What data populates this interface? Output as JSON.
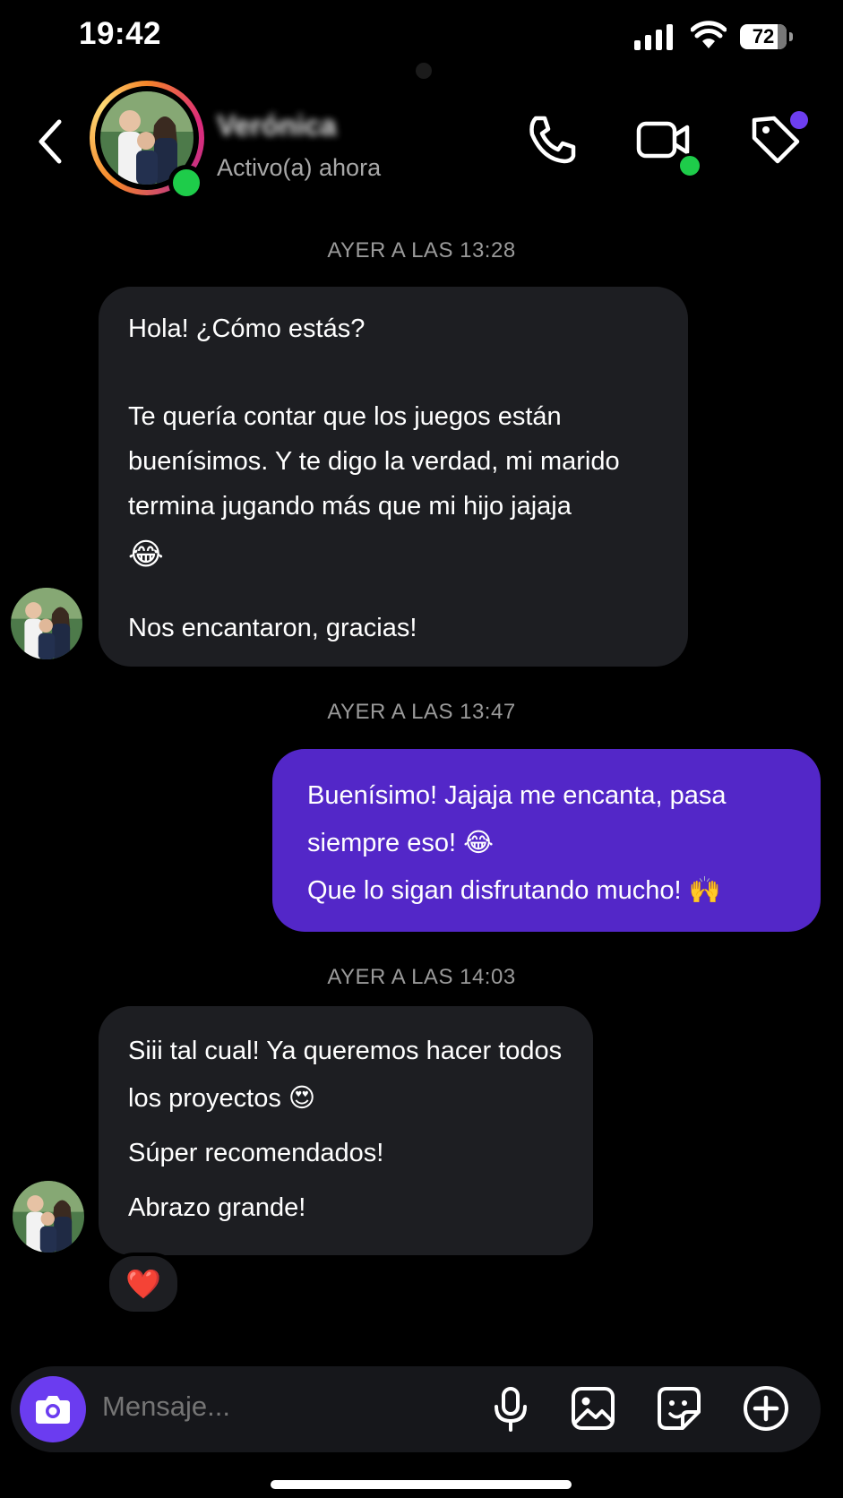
{
  "status_bar": {
    "time": "19:42",
    "battery": "72"
  },
  "header": {
    "contact_name": "Verónica",
    "status": "Activo(a) ahora",
    "icons": [
      "back-chevron-icon",
      "phone-icon",
      "video-call-icon",
      "tag-icon"
    ]
  },
  "conversation": [
    {
      "type": "timestamp",
      "text": "AYER A LAS 13:28"
    },
    {
      "type": "received",
      "paragraphs": [
        "Hola! ¿Cómo estás?",
        "Te quería contar que los juegos están buenísimos. Y te digo la verdad, mi marido termina jugando más que mi hijo jajaja",
        "😂",
        "Nos encantaron, gracias!"
      ]
    },
    {
      "type": "timestamp",
      "text": "AYER A LAS 13:47"
    },
    {
      "type": "sent",
      "paragraphs": [
        "Buenísimo! Jajaja me encanta, pasa siempre eso! 😂",
        "Que lo sigan disfrutando mucho! 🙌"
      ]
    },
    {
      "type": "timestamp",
      "text": "AYER A LAS 14:03"
    },
    {
      "type": "received",
      "paragraphs": [
        "Siii tal cual! Ya queremos hacer todos los proyectos 😍",
        "Súper recomendados!",
        "Abrazo grande!"
      ],
      "reaction": "❤️"
    }
  ],
  "composer": {
    "placeholder": "Mensaje...",
    "icons": [
      "camera-icon",
      "microphone-icon",
      "gallery-icon",
      "sticker-icon",
      "add-icon"
    ]
  },
  "colors": {
    "sent_bubble": "#5327c8",
    "received_bubble": "#1d1e22",
    "online": "#1ecc4a",
    "accent": "#6b3cf0"
  }
}
